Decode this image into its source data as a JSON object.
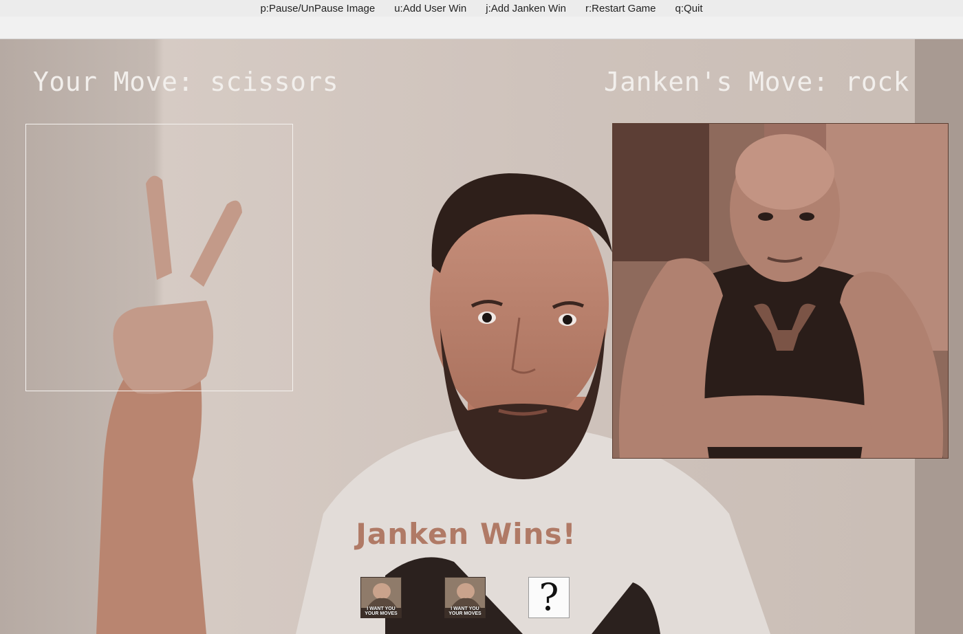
{
  "shortcuts": [
    "p:Pause/UnPause Image",
    "u:Add User Win",
    "j:Add Janken Win",
    "r:Restart Game",
    "q:Quit"
  ],
  "game": {
    "user_move_label": "Your Move: scissors",
    "janken_move_label": "Janken's Move: rock",
    "result": "Janken Wins!",
    "score_slots": [
      {
        "type": "win-poster",
        "icon": "janken-win-poster-icon",
        "text": "I WANT YOU YOUR MOVES"
      },
      {
        "type": "win-poster",
        "icon": "janken-win-poster-icon",
        "text": "I WANT YOU YOUR MOVES"
      },
      {
        "type": "unknown",
        "icon": "question-mark-icon",
        "text": "?"
      }
    ]
  },
  "colors": {
    "result_text": "#b07a66",
    "label_text": "#f2efec"
  }
}
